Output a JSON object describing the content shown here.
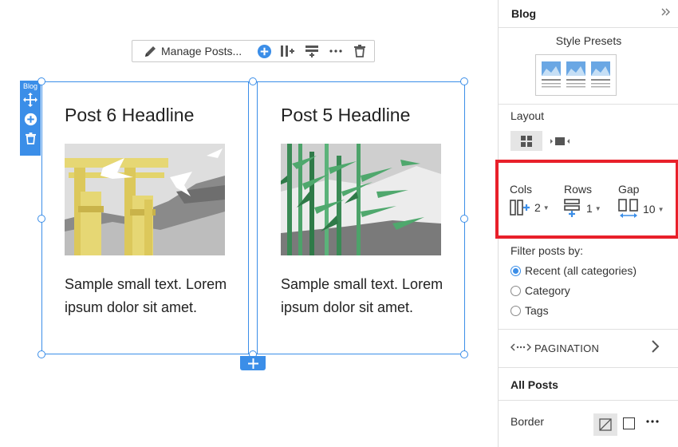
{
  "toolbar": {
    "manage_label": "Manage Posts...",
    "icons": [
      "pencil-icon",
      "add-circle-icon",
      "add-column-icon",
      "add-row-icon",
      "more-icon",
      "trash-icon"
    ]
  },
  "blog_tag": {
    "label": "Blog",
    "icons": [
      "move-icon",
      "add-circle-icon",
      "trash-icon"
    ]
  },
  "posts": [
    {
      "headline": "Post 6 Headline",
      "text": "Sample small text. Lorem ipsum dolor sit amet."
    },
    {
      "headline": "Post 5 Headline",
      "text": "Sample small text. Lorem ipsum dolor sit amet."
    }
  ],
  "panel": {
    "title": "Blog",
    "style_presets_label": "Style Presets",
    "layout_label": "Layout",
    "grid": {
      "cols_label": "Cols",
      "cols_value": "2",
      "rows_label": "Rows",
      "rows_value": "1",
      "gap_label": "Gap",
      "gap_value": "10"
    },
    "filter": {
      "title": "Filter posts by:",
      "options": [
        "Recent (all categories)",
        "Category",
        "Tags"
      ],
      "selected": "Recent (all categories)"
    },
    "pagination_label": "PAGINATION",
    "all_posts_label": "All Posts",
    "border_label": "Border"
  },
  "colors": {
    "accent": "#3b8ee8",
    "highlight": "#e8202a"
  }
}
